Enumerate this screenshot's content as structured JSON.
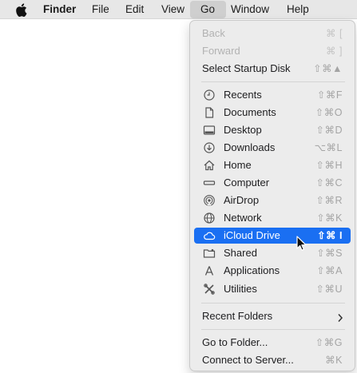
{
  "menubar": {
    "apple": "",
    "app_name": "Finder",
    "items": [
      "File",
      "Edit",
      "View",
      "Go",
      "Window",
      "Help"
    ]
  },
  "go_menu": {
    "back": {
      "label": "Back",
      "shortcut": "⌘ ["
    },
    "forward": {
      "label": "Forward",
      "shortcut": "⌘ ]"
    },
    "startup": {
      "label": "Select Startup Disk",
      "shortcut": "⇧⌘▲"
    },
    "recents": {
      "label": "Recents",
      "shortcut": "⇧⌘F"
    },
    "documents": {
      "label": "Documents",
      "shortcut": "⇧⌘O"
    },
    "desktop": {
      "label": "Desktop",
      "shortcut": "⇧⌘D"
    },
    "downloads": {
      "label": "Downloads",
      "shortcut": "⌥⌘L"
    },
    "home": {
      "label": "Home",
      "shortcut": "⇧⌘H"
    },
    "computer": {
      "label": "Computer",
      "shortcut": "⇧⌘C"
    },
    "airdrop": {
      "label": "AirDrop",
      "shortcut": "⇧⌘R"
    },
    "network": {
      "label": "Network",
      "shortcut": "⇧⌘K"
    },
    "icloud": {
      "label": "iCloud Drive",
      "shortcut": "⇧⌘ I"
    },
    "shared": {
      "label": "Shared",
      "shortcut": "⇧⌘S"
    },
    "applications": {
      "label": "Applications",
      "shortcut": "⇧⌘A"
    },
    "utilities": {
      "label": "Utilities",
      "shortcut": "⇧⌘U"
    },
    "recent_folders": {
      "label": "Recent Folders"
    },
    "goto_folder": {
      "label": "Go to Folder...",
      "shortcut": "⇧⌘G"
    },
    "connect_server": {
      "label": "Connect to Server...",
      "shortcut": "⌘K"
    }
  },
  "colors": {
    "highlight": "#1a6ff2",
    "menu_bg": "#ececec",
    "menubar_bg": "#e7e7e7"
  }
}
